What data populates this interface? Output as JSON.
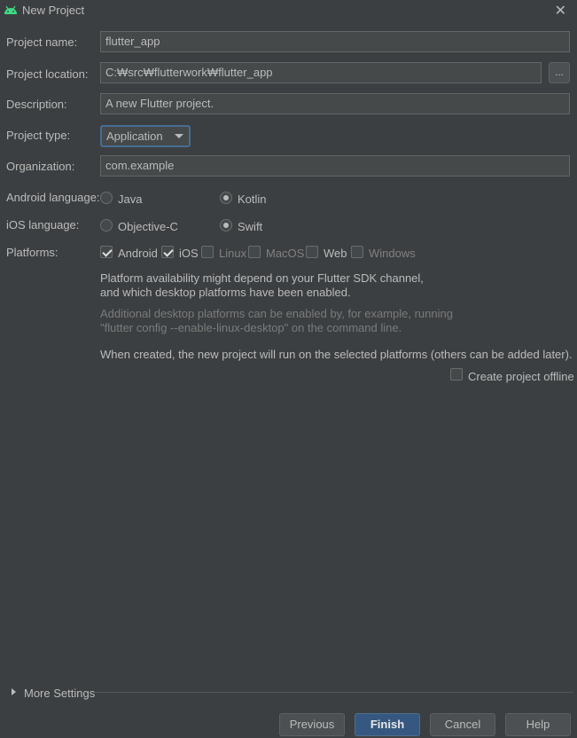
{
  "window": {
    "title": "New Project",
    "close_icon": "close-icon",
    "app_icon": "android-icon",
    "accent_color": "#3ddc84"
  },
  "form": {
    "project_name": {
      "label": "Project name:",
      "value": "flutter_app"
    },
    "project_location": {
      "label": "Project location:",
      "value": "C:₩src₩flutterwork₩flutter_app",
      "browse_label": "..."
    },
    "description": {
      "label": "Description:",
      "value": "A new Flutter project."
    },
    "project_type": {
      "label": "Project type:",
      "value": "Application"
    },
    "organization": {
      "label": "Organization:",
      "value": "com.example"
    },
    "android_language": {
      "label": "Android language:",
      "options": [
        "Java",
        "Kotlin"
      ],
      "selected": "Kotlin"
    },
    "ios_language": {
      "label": "iOS language:",
      "options": [
        "Objective-C",
        "Swift"
      ],
      "selected": "Swift"
    },
    "platforms": {
      "label": "Platforms:",
      "items": [
        {
          "name": "Android",
          "checked": true,
          "enabled": true
        },
        {
          "name": "iOS",
          "checked": true,
          "enabled": true
        },
        {
          "name": "Linux",
          "checked": false,
          "enabled": false
        },
        {
          "name": "MacOS",
          "checked": false,
          "enabled": false
        },
        {
          "name": "Web",
          "checked": false,
          "enabled": true
        },
        {
          "name": "Windows",
          "checked": false,
          "enabled": false
        }
      ]
    },
    "notes": {
      "availability_line1": "Platform availability might depend on your Flutter SDK channel,",
      "availability_line2": "and which desktop platforms have been enabled.",
      "additional_line1": "Additional desktop platforms can be enabled by, for example, running",
      "additional_line2": "\"flutter config --enable-linux-desktop\" on the command line.",
      "when_created": "When created, the new project will run on the selected platforms (others can be added later)."
    },
    "create_offline": {
      "label": "Create project offline",
      "checked": false
    }
  },
  "more_settings": {
    "label": "More Settings"
  },
  "buttons": {
    "previous": "Previous",
    "finish": "Finish",
    "cancel": "Cancel",
    "help": "Help"
  }
}
